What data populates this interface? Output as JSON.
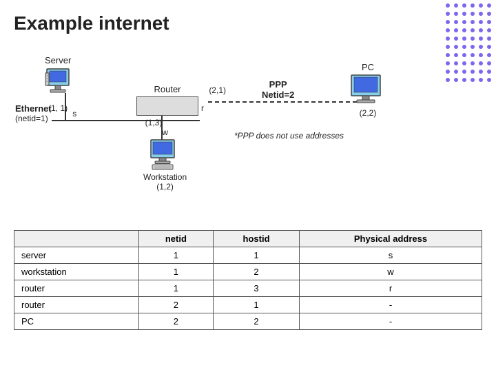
{
  "title": "Example internet",
  "diagram": {
    "server_label": "Server",
    "server_coord": "(1, 1)",
    "server_host": "s",
    "router_label": "Router",
    "router_coord_top": "(2,1)",
    "router_coord_bottom": "(1,3)",
    "router_host": "r",
    "workstation_label": "Workstation",
    "workstation_coord": "(1,2)",
    "workstation_host": "w",
    "pc_label": "PC",
    "pc_coord": "(2,2)",
    "ppp_label": "PPP",
    "ppp_netid": "Netid=2",
    "ethernet_label": "Ethernet",
    "ethernet_netid": "(netid=1)",
    "ppp_note": "*PPP does not use addresses"
  },
  "table": {
    "headers": [
      "",
      "netid",
      "hostid",
      "Physical address"
    ],
    "rows": [
      {
        "device": "server",
        "netid": "1",
        "hostid": "1",
        "physical": "s"
      },
      {
        "device": "workstation",
        "netid": "1",
        "hostid": "2",
        "physical": "w"
      },
      {
        "device": "router",
        "netid": "1",
        "hostid": "3",
        "physical": "r"
      },
      {
        "device": "router",
        "netid": "2",
        "hostid": "1",
        "physical": "-"
      },
      {
        "device": "PC",
        "netid": "2",
        "hostid": "2",
        "physical": "-"
      }
    ]
  }
}
